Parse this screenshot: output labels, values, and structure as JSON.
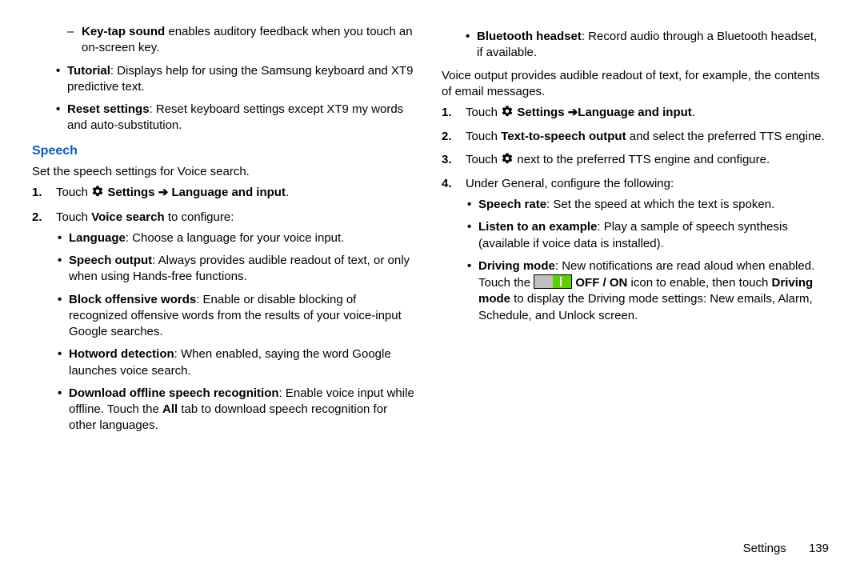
{
  "left": {
    "dash_items": [
      {
        "bold": "Key-tap sound",
        "rest": " enables auditory feedback when you touch an on-screen key."
      }
    ],
    "top_bullets": [
      {
        "bold": "Tutorial",
        "rest": ": Displays help for using the Samsung keyboard and XT9 predictive text."
      },
      {
        "bold": "Reset settings",
        "rest": ": Reset keyboard settings except XT9 my words and auto-substitution."
      }
    ],
    "section_title": "Speech",
    "section_intro": "Set the speech settings for Voice search.",
    "steps": {
      "s1": {
        "touch": "Touch ",
        "settings_arrow": "Settings ➔ Language and input",
        "end": "."
      },
      "s2": {
        "touch": "Touch ",
        "bold": "Voice search",
        "rest": " to configure:"
      }
    },
    "voice_bullets": [
      {
        "bold": "Language",
        "rest": ": Choose a language for your voice input."
      },
      {
        "bold": "Speech output",
        "rest": ": Always provides audible readout of text, or only when using Hands-free functions."
      },
      {
        "bold": "Block offensive words",
        "rest": ": Enable or disable blocking of recognized offensive words from the results of your voice-input Google searches."
      },
      {
        "bold": "Hotword detection",
        "rest": ": When enabled, saying the word Google launches voice search."
      },
      {
        "bold": "Download offline speech recognition",
        "rest": ": Enable voice input while offline. Touch the ",
        "bold2": "All",
        "rest2": " tab to download speech recognition for other languages."
      }
    ]
  },
  "right": {
    "top_bullets": [
      {
        "bold": "Bluetooth headset",
        "rest": ": Record audio through a Bluetooth headset, if available."
      }
    ],
    "intro": "Voice output provides audible readout of text, for example, the contents of email messages.",
    "steps": {
      "s1": {
        "touch": "Touch ",
        "settings_arrow": "Settings ➔Language and input",
        "end": "."
      },
      "s2": {
        "touch": "Touch ",
        "bold": "Text-to-speech output",
        "rest": " and select the preferred TTS engine."
      },
      "s3": {
        "touch": "Touch ",
        "rest": " next to the preferred TTS engine and configure."
      },
      "s4": {
        "text": "Under General, configure the following:"
      }
    },
    "general_bullets": [
      {
        "bold": "Speech rate",
        "rest": ": Set the speed at which the text is spoken."
      },
      {
        "bold": "Listen to an example",
        "rest": ": Play a sample of speech synthesis (available if voice data is installed)."
      },
      {
        "bold": "Driving mode",
        "rest": ": New notifications are read aloud when enabled. Touch the ",
        "offon": " OFF / ON",
        "rest2": " icon to enable, then touch ",
        "bold2": "Driving mode",
        "rest3": " to display the Driving mode settings: New emails, Alarm, Schedule, and Unlock screen."
      }
    ]
  },
  "footer": {
    "section": "Settings",
    "page": "139"
  }
}
